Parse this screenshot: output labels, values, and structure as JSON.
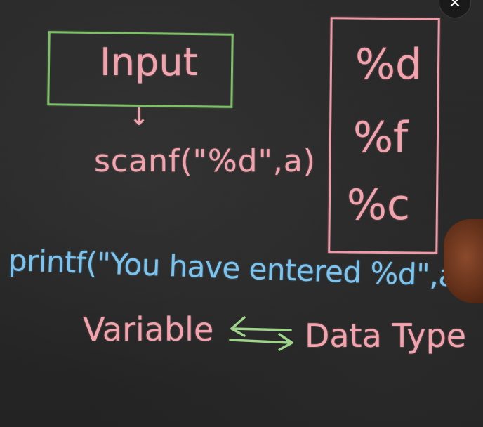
{
  "board": {
    "input_box_label": "Input",
    "arrow": "↓",
    "scanf_line": "scanf(\"%d\",a)",
    "format_specifiers": [
      "%d",
      "%f",
      "%c"
    ],
    "printf_line": "printf(\"You have entered %d\",a)",
    "variable_label": "Variable",
    "data_type_label": "Data Type",
    "exchange_arrows_icon": "left-right-double-arrow"
  },
  "colors": {
    "chalk_pink": "#f2a3ae",
    "chalk_blue": "#7cc4f0",
    "chalk_green": "#7fbf6a",
    "board": "#262626"
  },
  "overlay": {
    "close_icon": "close-icon",
    "close_glyph": "✕"
  }
}
